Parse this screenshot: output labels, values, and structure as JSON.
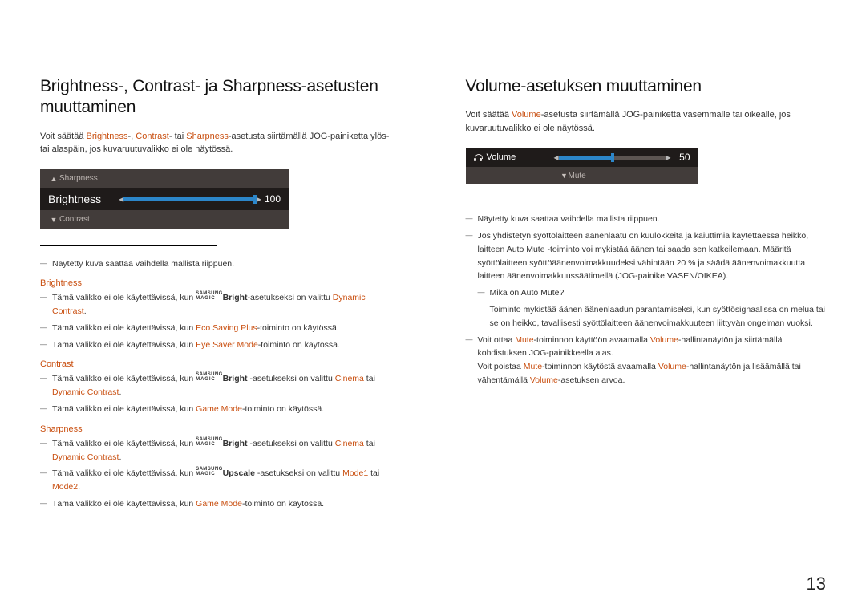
{
  "pageNumber": "13",
  "left": {
    "heading": "Brightness-, Contrast- ja Sharpness-asetusten muuttaminen",
    "intro_pre": "Voit säätää ",
    "intro_hl1": "Brightness",
    "intro_mid1": "-, ",
    "intro_hl2": "Contrast",
    "intro_mid2": "- tai ",
    "intro_hl3": "Sharpness",
    "intro_post": "-asetusta siirtämällä JOG-painiketta ylös- tai alaspäin, jos kuvaruutuvalikko ei ole näytössä.",
    "osd": {
      "top": "Sharpness",
      "main": "Brightness",
      "value": "100",
      "bottom": "Contrast"
    },
    "note_img": "Näytetty kuva saattaa vaihdella mallista riippuen.",
    "brightness": {
      "title": "Brightness",
      "items": [
        {
          "pre": "Tämä valikko ei ole käytettävissä, kun ",
          "magic": true,
          "magic_post": "Bright",
          "mid": "-asetukseksi on valittu ",
          "hl": "Dynamic Contrast",
          "post": "."
        },
        {
          "pre": "Tämä valikko ei ole käytettävissä, kun ",
          "hl": "Eco Saving Plus",
          "post": "-toiminto on käytössä."
        },
        {
          "pre": "Tämä valikko ei ole käytettävissä, kun ",
          "hl": "Eye Saver Mode",
          "post": "-toiminto on käytössä."
        }
      ]
    },
    "contrast": {
      "title": "Contrast",
      "items": [
        {
          "pre": "Tämä valikko ei ole käytettävissä, kun ",
          "magic": true,
          "magic_post": "Bright",
          "mid": " -asetukseksi on valittu ",
          "hl": "Cinema",
          "mid2": " tai ",
          "hl2": "Dynamic Contrast",
          "post": "."
        },
        {
          "pre": "Tämä valikko ei ole käytettävissä, kun ",
          "hl": "Game Mode",
          "post": "-toiminto on käytössä."
        }
      ]
    },
    "sharpness": {
      "title": "Sharpness",
      "items": [
        {
          "pre": "Tämä valikko ei ole käytettävissä, kun ",
          "magic": true,
          "magic_post": "Bright",
          "mid": " -asetukseksi on valittu ",
          "hl": "Cinema",
          "mid2": " tai ",
          "hl2": "Dynamic Contrast",
          "post": "."
        },
        {
          "pre": "Tämä valikko ei ole käytettävissä, kun ",
          "magic": true,
          "magic_post": "Upscale",
          "mid": " -asetukseksi on valittu ",
          "hl": "Mode1",
          "mid2": " tai ",
          "hl2": "Mode2",
          "post": "."
        },
        {
          "pre": "Tämä valikko ei ole käytettävissä, kun ",
          "hl": "Game Mode",
          "post": "-toiminto on käytössä."
        }
      ]
    }
  },
  "right": {
    "heading": "Volume-asetuksen muuttaminen",
    "intro_pre": "Voit säätää ",
    "intro_hl": "Volume",
    "intro_post": "-asetusta siirtämällä JOG-painiketta vasemmalle tai oikealle, jos kuvaruutuvalikko ei ole näytössä.",
    "osd": {
      "label": "Volume",
      "value": "50",
      "mute": "Mute"
    },
    "note_img": "Näytetty kuva saattaa vaihdella mallista riippuen.",
    "note_bullet2": {
      "text": "Jos yhdistetyn syöttölaitteen äänenlaatu on kuulokkeita ja kaiuttimia käytettäessä heikko, laitteen Auto Mute -toiminto voi mykistää äänen tai saada sen katkeilemaan. Määritä syöttölaitteen syöttöäänenvoimakkuudeksi vähintään 20 % ja säädä äänenvoimakkuutta laitteen äänenvoimakkuussäätimellä (JOG-painike VASEN/OIKEA).",
      "sub_q": "Mikä on Auto Mute?",
      "sub_a": "Toiminto mykistää äänen äänenlaadun parantamiseksi, kun syöttösignaalissa on melua tai se on heikko, tavallisesti syöttölaitteen äänenvoimakkuuteen liittyvän ongelman vuoksi."
    },
    "note_bullet3": {
      "p1a": "Voit ottaa ",
      "p1h": "Mute",
      "p1b": "-toiminnon käyttöön avaamalla ",
      "p1h2": "Volume",
      "p1c": "-hallintanäytön ja siirtämällä kohdistuksen JOG-painikkeella alas.",
      "p2a": "Voit poistaa ",
      "p2h": "Mute",
      "p2b": "-toiminnon käytöstä avaamalla ",
      "p2h2": "Volume",
      "p2c": "-hallintanäytön ja lisäämällä tai vähentämällä ",
      "p2h3": "Volume",
      "p2d": "-asetuksen arvoa."
    }
  }
}
